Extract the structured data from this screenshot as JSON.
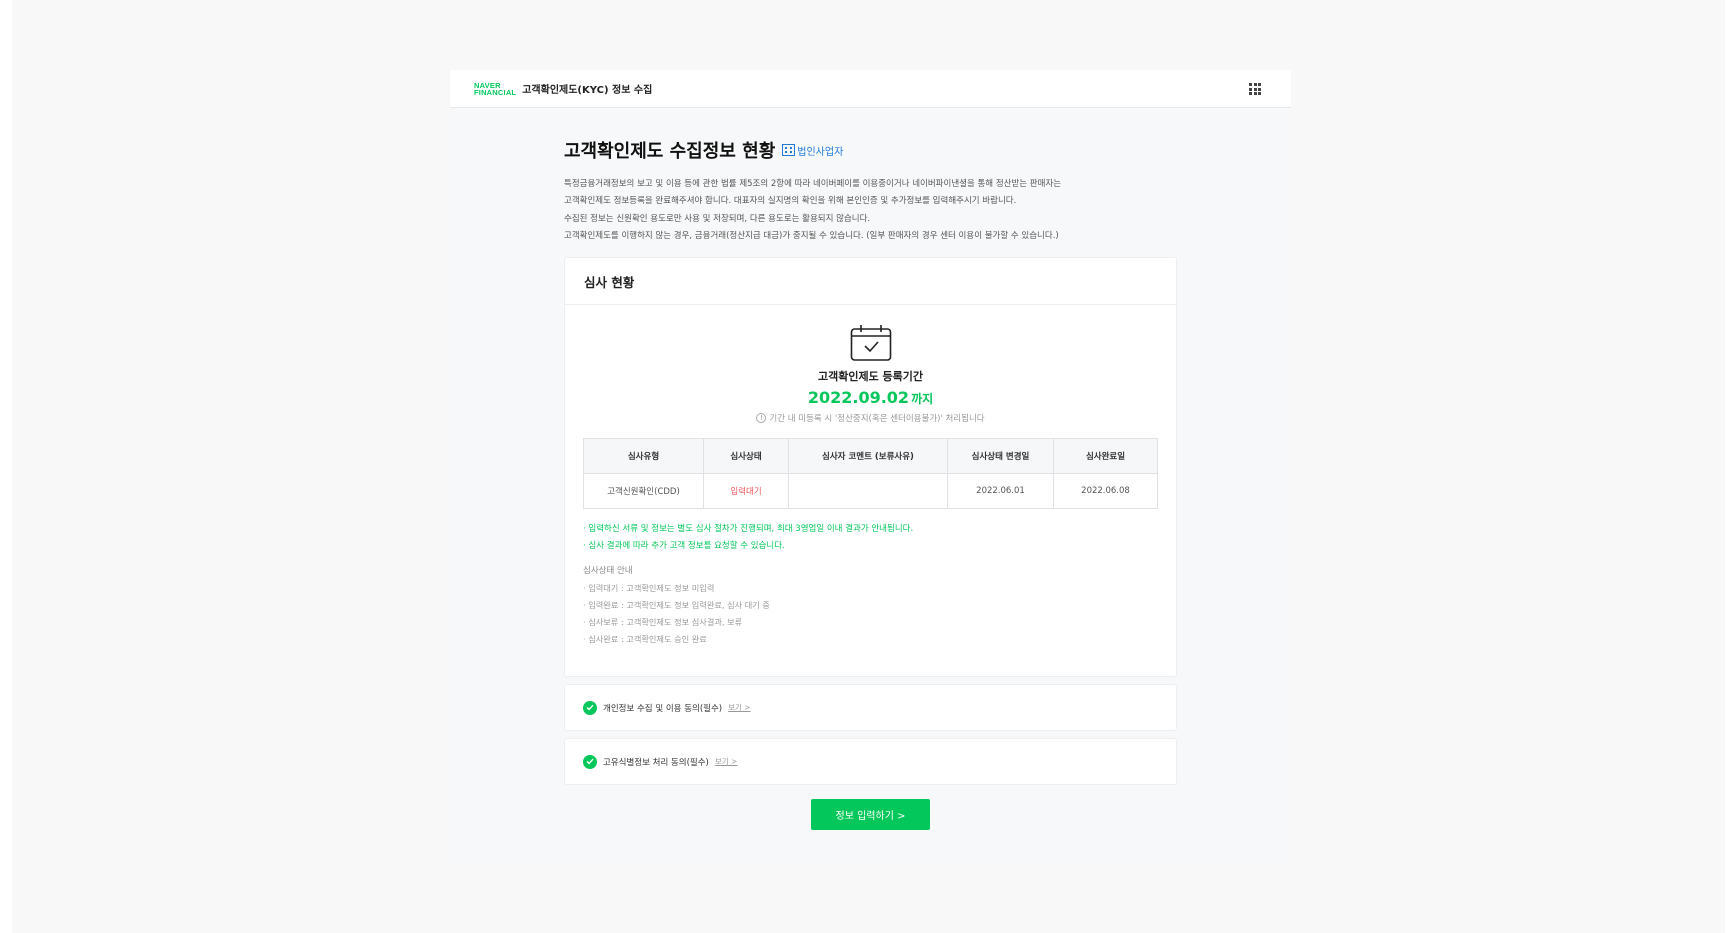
{
  "header": {
    "logo_line1": "NAVER",
    "logo_line2": "FINANCIAL",
    "title": "고객확인제도(KYC) 정보 수집",
    "menu_icon": "grid-menu-icon"
  },
  "page": {
    "title": "고객확인제도 수집정보 현황",
    "corp_badge": "법인사업자",
    "description": [
      "특정금융거래정보의 보고 및 이용 등에 관한 법률 제5조의 2항에 따라 네이버페이를 이용중이거나 네이버파이낸셜을 통해 정산받는 판매자는",
      "고객확인제도 정보등록을 완료해주셔야 합니다. 대표자의 실지명의 확인을 위해 본인인증 및 추가정보를 입력해주시기 바랍니다.",
      "수집된 정보는 신원확인 용도로만 사용 및 저장되며, 다른 용도로는 활용되지 않습니다.",
      "고객확인제도를 이행하지 않는 경우, 금융거래(정산지급 대금)가 중지될 수 있습니다. (일부 판매자의 경우 센터 이용이 불가할 수 있습니다.)"
    ]
  },
  "review": {
    "section_title": "심사 현황",
    "period_label": "고객확인제도 등록기간",
    "period_date": "2022.09.02",
    "period_suffix": "까지",
    "period_note": "기간 내 미등록 시 '정산중지(혹은 센터이용불가)' 처리됩니다",
    "columns": [
      "심사유형",
      "심사상태",
      "심사자 코멘트 (보류사유)",
      "심사상태 변경일",
      "심사완료일"
    ],
    "rows": [
      {
        "type": "고객신원확인(CDD)",
        "status": "입력대기",
        "comment": "",
        "changed": "2022.06.01",
        "completed": "2022.06.08"
      }
    ],
    "notes": [
      "· 입력하신 서류 및 정보는 별도 심사 절차가 진행되며, 최대 3영업일 이내 결과가 안내됩니다.",
      "· 심사 결과에 따라 추가 고객 정보를 요청할 수 있습니다."
    ],
    "guide_title": "심사상태 안내",
    "guide": [
      "· 입력대기 : 고객확인제도 정보 미입력",
      "· 입력완료 : 고객확인제도 정보 입력완료, 심사 대기 중",
      "· 심사보류 : 고객확인제도 정보 심사결과, 보류",
      "· 심사완료 : 고객확인제도 승인 완료"
    ]
  },
  "agreements": [
    {
      "label": "개인정보 수집 및 이용 동의(필수)",
      "link": "보기 >"
    },
    {
      "label": "고유식별정보 처리 동의(필수)",
      "link": "보기 >"
    }
  ],
  "submit_label": "정보 입력하기 >",
  "colors": {
    "accent": "#03c75a",
    "link": "#1f7ad8",
    "alert": "#f0555d"
  }
}
